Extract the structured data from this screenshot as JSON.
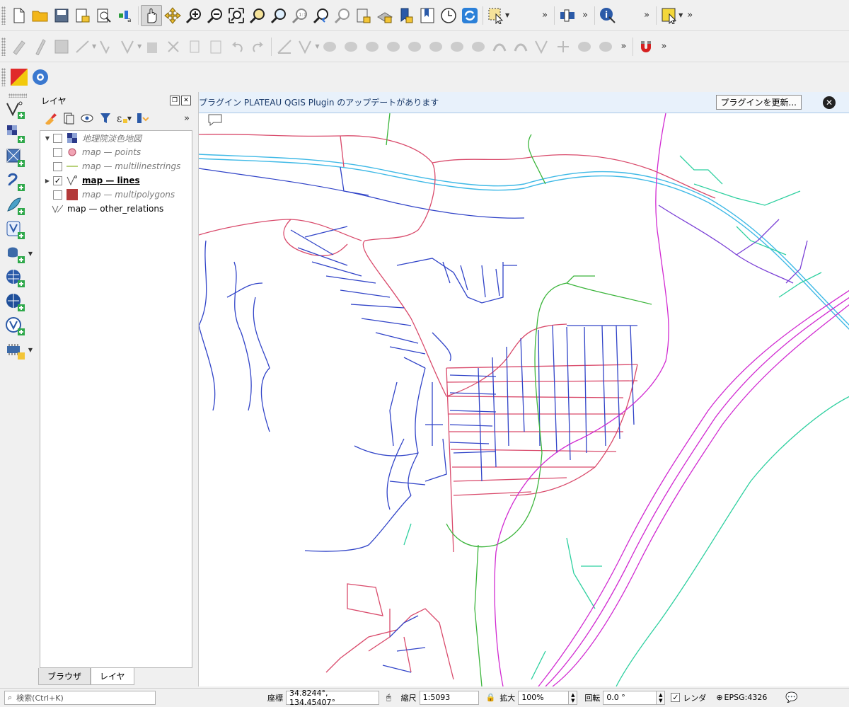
{
  "toolbar_row1": {
    "buttons": [
      "new-project",
      "open-project",
      "save-project",
      "new-print-layout",
      "style-manager",
      "open-layout",
      "pan-map",
      "pan-to-selection",
      "zoom-in",
      "zoom-out",
      "zoom-full",
      "zoom-to-selection",
      "zoom-to-layer",
      "zoom-native",
      "zoom-last",
      "zoom-next",
      "new-map-view",
      "new-3d-map",
      "new-bookmark",
      "show-bookmarks",
      "temporal-controller",
      "refresh",
      "select-features",
      "identify"
    ],
    "more_label": "»"
  },
  "toolbar_row3": {
    "buttons": [
      "plateau-plugin",
      "settings-gear"
    ]
  },
  "layers_panel": {
    "title": "レイヤ",
    "more_label": "»",
    "layers": [
      {
        "name": "地理院淡色地図",
        "checked": false,
        "expand": "▼",
        "style": "dim"
      },
      {
        "name": "map — points",
        "checked": false,
        "expand": "",
        "style": "dim"
      },
      {
        "name": "map — multilinestrings",
        "checked": false,
        "expand": "",
        "style": "dim"
      },
      {
        "name": "map — lines",
        "checked": true,
        "expand": "▶",
        "style": "bold"
      },
      {
        "name": "map — multipolygons",
        "checked": false,
        "expand": "",
        "style": "dim"
      },
      {
        "name": "map — other_relations",
        "checked": null,
        "expand": "",
        "style": "normal"
      }
    ],
    "tabs": [
      "ブラウザ",
      "レイヤ"
    ],
    "active_tab": "レイヤ"
  },
  "message_bar": {
    "text": "プラグイン PLATEAU QGIS Plugin のアップデートがあります",
    "button_label": "プラグインを更新..."
  },
  "statusbar": {
    "search_placeholder": "検索(Ctrl+K)",
    "coordinate_label": "座標",
    "coordinate_value": "34.8244°, 134.45407°",
    "scale_label": "縮尺",
    "scale_value": "1:5093",
    "magnifier_label": "拡大",
    "magnifier_value": "100%",
    "rotation_label": "回転",
    "rotation_value": "0.0 °",
    "render_label": "レンダ",
    "crs_label": "EPSG:4326"
  },
  "colors": {
    "road_red": "#d94a6b",
    "road_blue": "#3144c8",
    "river_cyan": "#3fb9e6",
    "green": "#3cb53c",
    "teal": "#2fd0a0",
    "magenta": "#d12ad1",
    "purple": "#7a3fd6"
  }
}
